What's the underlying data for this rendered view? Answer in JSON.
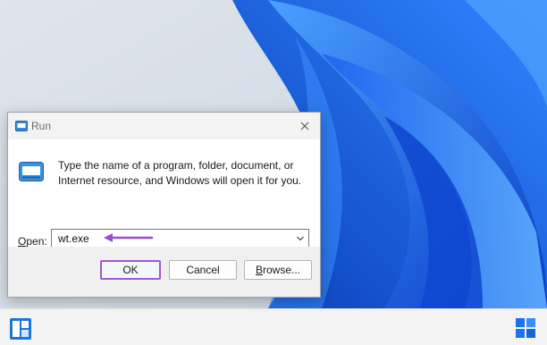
{
  "wallpaper": {
    "accent": "#1e6cf0",
    "bg": "#d6dde6"
  },
  "dialog": {
    "title": "Run",
    "icon": "run-icon",
    "description": "Type the name of a program, folder, document, or Internet resource, and Windows will open it for you.",
    "open_label_prefix": "O",
    "open_label_rest": "pen:",
    "command_value": "wt.exe",
    "buttons": {
      "ok": "OK",
      "cancel": "Cancel",
      "browse_u": "B",
      "browse_rest": "rowse..."
    }
  },
  "annotation": {
    "color": "#9b4fd0"
  },
  "taskbar": {
    "left_icon": "widgets-icon",
    "right_icon": "windows-start-icon"
  }
}
